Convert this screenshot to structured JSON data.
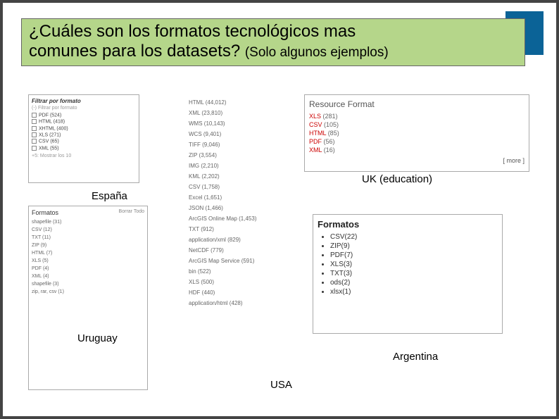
{
  "title": {
    "line1": "¿Cuáles son los formatos tecnológicos mas",
    "line2a": "comunes para los datasets?",
    "line2b": "(Solo algunos ejemplos)"
  },
  "spain": {
    "label": "España",
    "header": "Filtrar por formato",
    "toggle": "(-) Filtrar por formato",
    "items": [
      {
        "name": "PDF",
        "count": "(524)"
      },
      {
        "name": "HTML",
        "count": "(418)"
      },
      {
        "name": "XHTML",
        "count": "(400)"
      },
      {
        "name": "XLS",
        "count": "(271)"
      },
      {
        "name": "CSV",
        "count": "(65)"
      },
      {
        "name": "XML",
        "count": "(55)"
      }
    ],
    "more": "+5: Mostrar los 10"
  },
  "uruguay": {
    "label": "Uruguay",
    "header": "Formatos",
    "clear": "Borrar Todo",
    "items": [
      {
        "name": "shapefile",
        "count": "(31)"
      },
      {
        "name": "CSV",
        "count": "(12)"
      },
      {
        "name": "TXT",
        "count": "(11)"
      },
      {
        "name": "ZIP",
        "count": "(9)"
      },
      {
        "name": "HTML",
        "count": "(7)"
      },
      {
        "name": "XLS",
        "count": "(5)"
      },
      {
        "name": "PDF",
        "count": "(4)"
      },
      {
        "name": "XML",
        "count": "(4)"
      },
      {
        "name": "shapefile",
        "count": "(3)"
      },
      {
        "name": "zip, rar, csv",
        "count": "(1)"
      }
    ]
  },
  "usa": {
    "label": "USA",
    "items": [
      {
        "name": "HTML",
        "count": "(44,012)"
      },
      {
        "name": "XML",
        "count": "(23,810)"
      },
      {
        "name": "WMS",
        "count": "(10,143)"
      },
      {
        "name": "WCS",
        "count": "(9,401)"
      },
      {
        "name": "TIFF",
        "count": "(9,046)"
      },
      {
        "name": "ZIP",
        "count": "(3,554)"
      },
      {
        "name": "IMG",
        "count": "(2,210)"
      },
      {
        "name": "KML",
        "count": "(2,202)"
      },
      {
        "name": "CSV",
        "count": "(1,758)"
      },
      {
        "name": "Excel",
        "count": "(1,651)"
      },
      {
        "name": "JSON",
        "count": "(1,466)"
      },
      {
        "name": "ArcGIS Online Map",
        "count": "(1,453)"
      },
      {
        "name": "TXT",
        "count": "(912)"
      },
      {
        "name": "application/xml",
        "count": "(829)"
      },
      {
        "name": "NetCDF",
        "count": "(779)"
      },
      {
        "name": "ArcGIS Map Service",
        "count": "(591)"
      },
      {
        "name": "bin",
        "count": "(522)"
      },
      {
        "name": "XLS",
        "count": "(500)"
      },
      {
        "name": "HDF",
        "count": "(440)"
      },
      {
        "name": "application/html",
        "count": "(428)"
      }
    ]
  },
  "uk": {
    "label": "UK (education)",
    "header": "Resource Format",
    "items": [
      {
        "name": "XLS",
        "count": "(281)"
      },
      {
        "name": "CSV",
        "count": "(105)"
      },
      {
        "name": "HTML",
        "count": "(85)"
      },
      {
        "name": "PDF",
        "count": "(56)"
      },
      {
        "name": "XML",
        "count": "(16)"
      }
    ],
    "more": "[ more ]"
  },
  "argentina": {
    "label": "Argentina",
    "header": "Formatos",
    "items": [
      {
        "name": "CSV",
        "count": "(22)"
      },
      {
        "name": "ZIP",
        "count": "(9)"
      },
      {
        "name": "PDF",
        "count": "(7)"
      },
      {
        "name": "XLS",
        "count": "(3)"
      },
      {
        "name": "TXT",
        "count": "(3)"
      },
      {
        "name": "ods",
        "count": "(2)"
      },
      {
        "name": "xlsx",
        "count": "(1)"
      }
    ]
  }
}
